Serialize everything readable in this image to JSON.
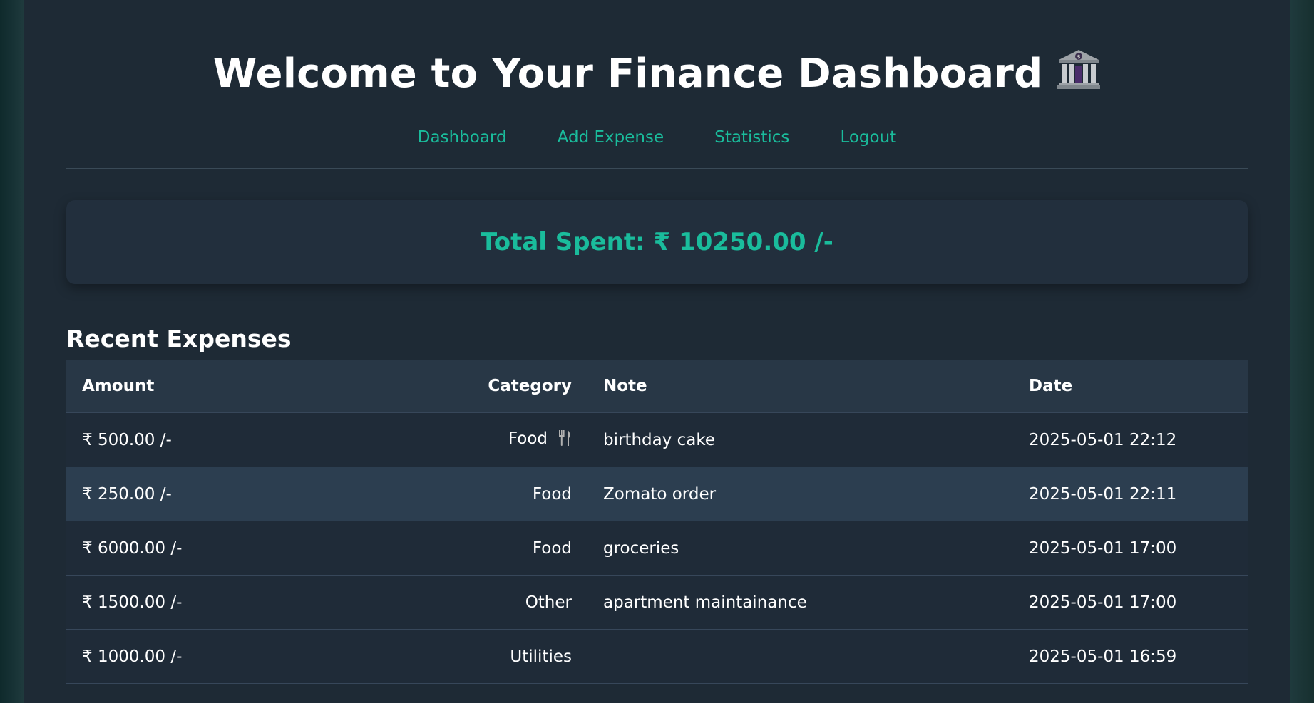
{
  "header": {
    "title": "Welcome to Your Finance Dashboard",
    "icon": "bank-icon"
  },
  "nav": {
    "items": [
      {
        "label": "Dashboard"
      },
      {
        "label": "Add Expense"
      },
      {
        "label": "Statistics"
      },
      {
        "label": "Logout"
      }
    ]
  },
  "summary": {
    "total_label": "Total Spent: ₹ 10250.00 /-"
  },
  "expenses": {
    "title": "Recent Expenses",
    "columns": [
      "Amount",
      "Category",
      "Note",
      "Date"
    ],
    "rows": [
      {
        "amount": "₹ 500.00 /-",
        "category": "Food",
        "category_icon": "fork-knife-icon",
        "note": "birthday cake",
        "date": "2025-05-01 22:12"
      },
      {
        "amount": "₹ 250.00 /-",
        "category": "Food",
        "note": "Zomato order",
        "date": "2025-05-01 22:11"
      },
      {
        "amount": "₹ 6000.00 /-",
        "category": "Food",
        "note": "groceries",
        "date": "2025-05-01 17:00"
      },
      {
        "amount": "₹ 1500.00 /-",
        "category": "Other",
        "note": "apartment maintainance",
        "date": "2025-05-01 17:00"
      },
      {
        "amount": "₹ 1000.00 /-",
        "category": "Utilities",
        "note": "",
        "date": "2025-05-01 16:59"
      }
    ]
  },
  "colors": {
    "accent": "#1abc9c",
    "background": "#1e2a35",
    "card": "#222f3d",
    "table_header": "#283746",
    "row_highlight": "#2c3e50"
  }
}
